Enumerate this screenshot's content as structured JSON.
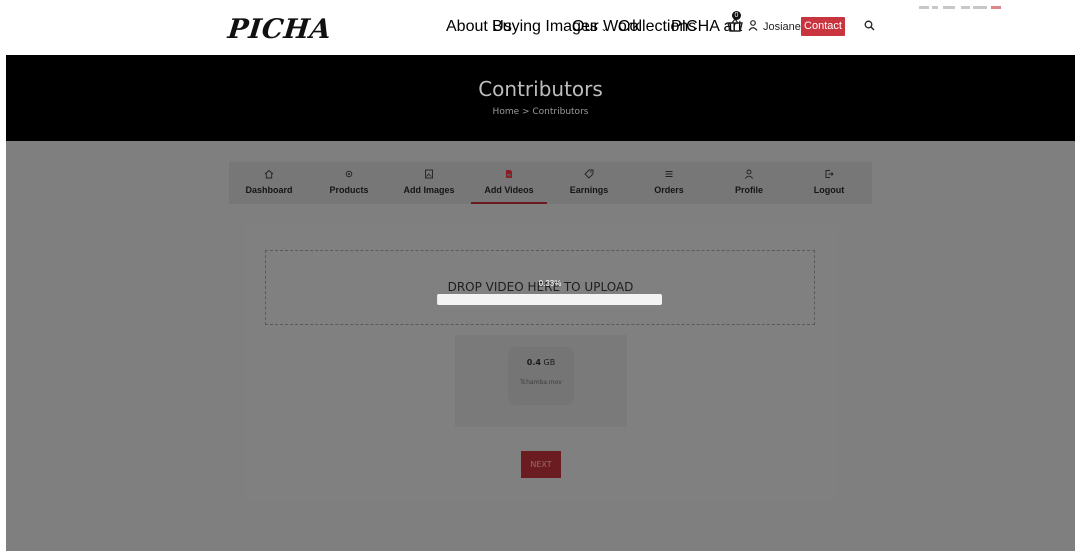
{
  "header": {
    "logo": "PICHA",
    "nav": {
      "about": "About Us",
      "buying": "Buying Images",
      "work": "Our Work",
      "collections": "Collections",
      "art": "PICHA art"
    },
    "cart_count": "0",
    "user_name": "Josiane",
    "contact": "Contact"
  },
  "hero": {
    "title": "Contributors",
    "breadcrumb": "Home > Contributors"
  },
  "tabs": [
    {
      "label": "Dashboard",
      "icon": "home-icon"
    },
    {
      "label": "Products",
      "icon": "gear-icon"
    },
    {
      "label": "Add Images",
      "icon": "image-icon"
    },
    {
      "label": "Add Videos",
      "icon": "video-file-icon",
      "active": true
    },
    {
      "label": "Earnings",
      "icon": "tag-icon"
    },
    {
      "label": "Orders",
      "icon": "list-icon"
    },
    {
      "label": "Profile",
      "icon": "user-icon"
    },
    {
      "label": "Logout",
      "icon": "logout-icon"
    }
  ],
  "upload": {
    "drop_text": "DROP VIDEO HERE TO UPLOAD",
    "progress_label": "0.33%",
    "progress_fraction": 0.0033
  },
  "file": {
    "size_value": "0.4",
    "size_unit": "GB",
    "name": "Tchamba.mov"
  },
  "next_label": "NEXT",
  "colors": {
    "accent": "#c9353f",
    "hero_bg": "#000000",
    "active_tab_underline": "#6a1b20"
  }
}
